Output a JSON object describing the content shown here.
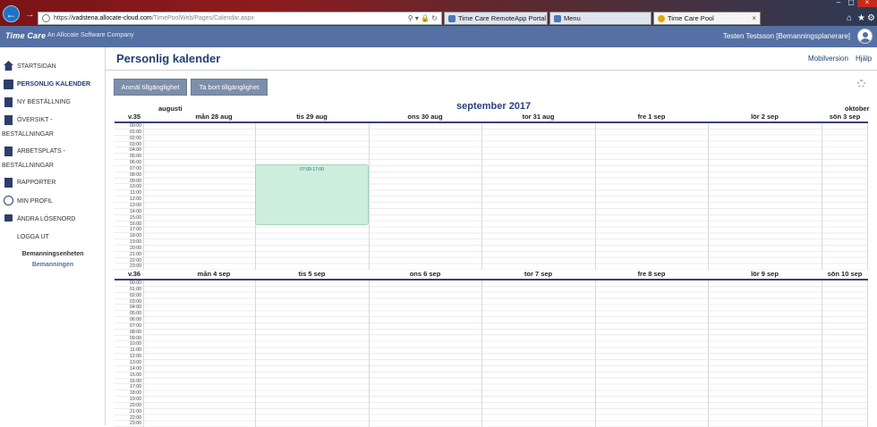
{
  "browser": {
    "url_prefix": "https://",
    "url_mid": "vadstena.allocate-cloud.com",
    "url_rest": "/TimePoolWeb/Pages/Calendar.aspx",
    "tools": "⚲ ▾ 🔒 ↻",
    "tabs": [
      {
        "label": "Time Care RemoteApp Portal",
        "color": "#4a78b8"
      },
      {
        "label": "Menu",
        "color": "#4a78b8"
      },
      {
        "label": "Time Care Pool",
        "color": "#e0a800"
      }
    ],
    "tab_close": "×",
    "home_icon": "⌂",
    "star_icon": "★",
    "gear_icon": "⚙",
    "win_min": "–",
    "win_max": "▢",
    "win_close": "×"
  },
  "header": {
    "logo": "Time Care",
    "company": "An Allocate Software Company",
    "user": "Testen Testsson [Bemanningsplanerare]"
  },
  "sidebar": {
    "items": [
      {
        "label": "Startsidan",
        "icon": "home-icon"
      },
      {
        "label": "Personlig kalender",
        "icon": "calendar-icon"
      },
      {
        "label": "Ny beställning",
        "icon": "document-icon"
      },
      {
        "label": "Översikt -",
        "label2": "beställningar",
        "icon": "document-icon"
      },
      {
        "label": "Arbetsplats -",
        "label2": "beställningar",
        "icon": "document-icon"
      },
      {
        "label": "Rapporter",
        "icon": "report-icon"
      },
      {
        "label": "Min profil",
        "icon": "user-icon"
      },
      {
        "label": "Ändra lösenord",
        "icon": "lock-icon"
      },
      {
        "label": "Logga ut"
      }
    ],
    "unit_label": "Bemanningsenheten",
    "unit_value": "Bemanningen"
  },
  "main": {
    "title": "Personlig kalender",
    "mobile_link": "Mobilversion",
    "help_link": "Hjälp",
    "btn_report": "Anmäl tillgänglighet",
    "btn_remove": "Ta bort tillgänglighet",
    "prev_month": "augusti",
    "current_month": "september 2017",
    "next_month": "oktober"
  },
  "hours": [
    "00:00",
    "01:00",
    "02:00",
    "03:00",
    "04:00",
    "05:00",
    "06:00",
    "07:00",
    "08:00",
    "09:00",
    "10:00",
    "11:00",
    "12:00",
    "13:00",
    "14:00",
    "15:00",
    "16:00",
    "17:00",
    "18:00",
    "19:00",
    "20:00",
    "21:00",
    "22:00",
    "23:00"
  ],
  "weeks": [
    {
      "label": "v.35",
      "days": [
        "mån 28 aug",
        "tis 29 aug",
        "ons 30 aug",
        "tor 31 aug",
        "fre 1 sep",
        "lör 2 sep",
        "sön 3 sep"
      ],
      "event": {
        "text": "07:00-17:00"
      }
    },
    {
      "label": "v.36",
      "days": [
        "mån 4 sep",
        "tis 5 sep",
        "ons 6 sep",
        "tor 7 sep",
        "fre 8 sep",
        "lör 9 sep",
        "sön 10 sep"
      ]
    }
  ]
}
